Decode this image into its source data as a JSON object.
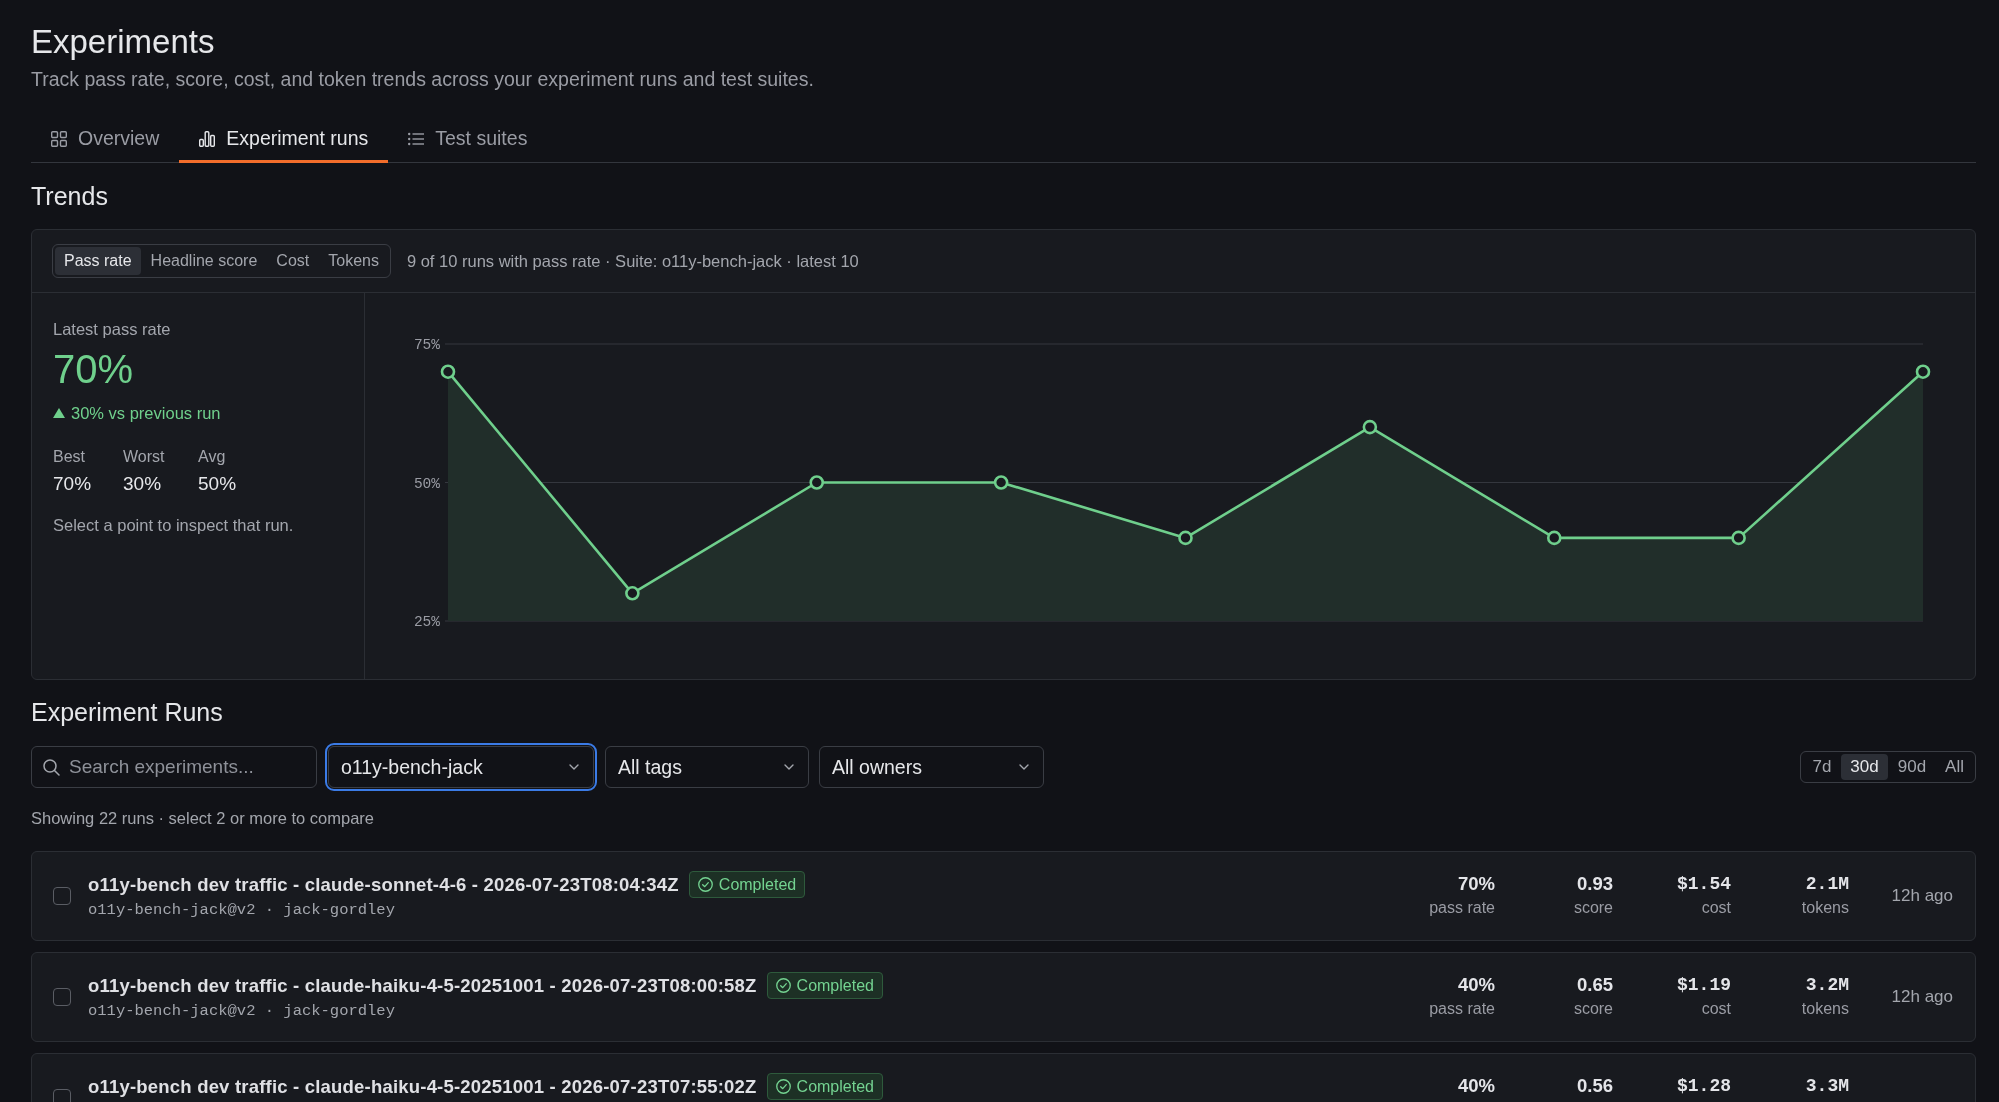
{
  "header": {
    "title": "Experiments",
    "subtitle": "Track pass rate, score, cost, and token trends across your experiment runs and test suites."
  },
  "tabs": [
    {
      "label": "Overview",
      "selected": false
    },
    {
      "label": "Experiment runs",
      "selected": true
    },
    {
      "label": "Test suites",
      "selected": false
    }
  ],
  "trends": {
    "heading": "Trends",
    "metrics": [
      {
        "label": "Pass rate",
        "selected": true
      },
      {
        "label": "Headline score",
        "selected": false
      },
      {
        "label": "Cost",
        "selected": false
      },
      {
        "label": "Tokens",
        "selected": false
      }
    ],
    "summary": "9 of 10 runs with pass rate · Suite: o11y-bench-jack · latest 10",
    "latest": {
      "label": "Latest pass rate",
      "value": "70%",
      "change": "30% vs previous run"
    },
    "stats": [
      {
        "label": "Best",
        "value": "70%"
      },
      {
        "label": "Worst",
        "value": "30%"
      },
      {
        "label": "Avg",
        "value": "50%"
      }
    ],
    "hint": "Select a point to inspect that run.",
    "chart_data": {
      "type": "area",
      "values": [
        70,
        30,
        50,
        50,
        40,
        60,
        40,
        40,
        70
      ],
      "ylim": [
        25,
        75
      ],
      "yticks": [
        {
          "value": 25,
          "label": "25%"
        },
        {
          "value": 50,
          "label": "50%"
        },
        {
          "value": 75,
          "label": "75%"
        }
      ]
    }
  },
  "runs": {
    "heading": "Experiment Runs",
    "search": {
      "placeholder": "Search experiments..."
    },
    "filters": [
      {
        "value": "o11y-bench-jack",
        "focused": true
      },
      {
        "value": "All tags",
        "focused": false
      },
      {
        "value": "All owners",
        "focused": false
      }
    ],
    "ranges": [
      {
        "label": "7d",
        "selected": false
      },
      {
        "label": "30d",
        "selected": true
      },
      {
        "label": "90d",
        "selected": false
      },
      {
        "label": "All",
        "selected": false
      }
    ],
    "summary": "Showing 22 runs · select 2 or more to compare",
    "rows": [
      {
        "checked": false,
        "title": "o11y-bench dev traffic - claude-sonnet-4-6 - 2026-07-23T08:04:34Z",
        "status": "Completed",
        "meta": "o11y-bench-jack@v2 · jack-gordley",
        "metrics": [
          {
            "kind": "plain",
            "value": "70%",
            "label": "pass rate"
          },
          {
            "kind": "plain",
            "value": "0.93",
            "label": "score"
          },
          {
            "kind": "mono",
            "value": "$1.54",
            "label": "cost"
          },
          {
            "kind": "mono",
            "value": "2.1M",
            "label": "tokens"
          }
        ],
        "time": "12h ago"
      },
      {
        "checked": false,
        "title": "o11y-bench dev traffic - claude-haiku-4-5-20251001 - 2026-07-23T08:00:58Z",
        "status": "Completed",
        "meta": "o11y-bench-jack@v2 · jack-gordley",
        "metrics": [
          {
            "kind": "plain",
            "value": "40%",
            "label": "pass rate"
          },
          {
            "kind": "plain",
            "value": "0.65",
            "label": "score"
          },
          {
            "kind": "mono",
            "value": "$1.19",
            "label": "cost"
          },
          {
            "kind": "mono",
            "value": "3.2M",
            "label": "tokens"
          }
        ],
        "time": "12h ago"
      },
      {
        "checked": false,
        "title": "o11y-bench dev traffic - claude-haiku-4-5-20251001 - 2026-07-23T07:55:02Z",
        "status": "Completed",
        "metrics": [
          {
            "kind": "plain",
            "value": "40%"
          },
          {
            "kind": "plain",
            "value": "0.56"
          },
          {
            "kind": "mono",
            "value": "$1.28"
          },
          {
            "kind": "mono",
            "value": "3.3M"
          }
        ]
      }
    ]
  }
}
